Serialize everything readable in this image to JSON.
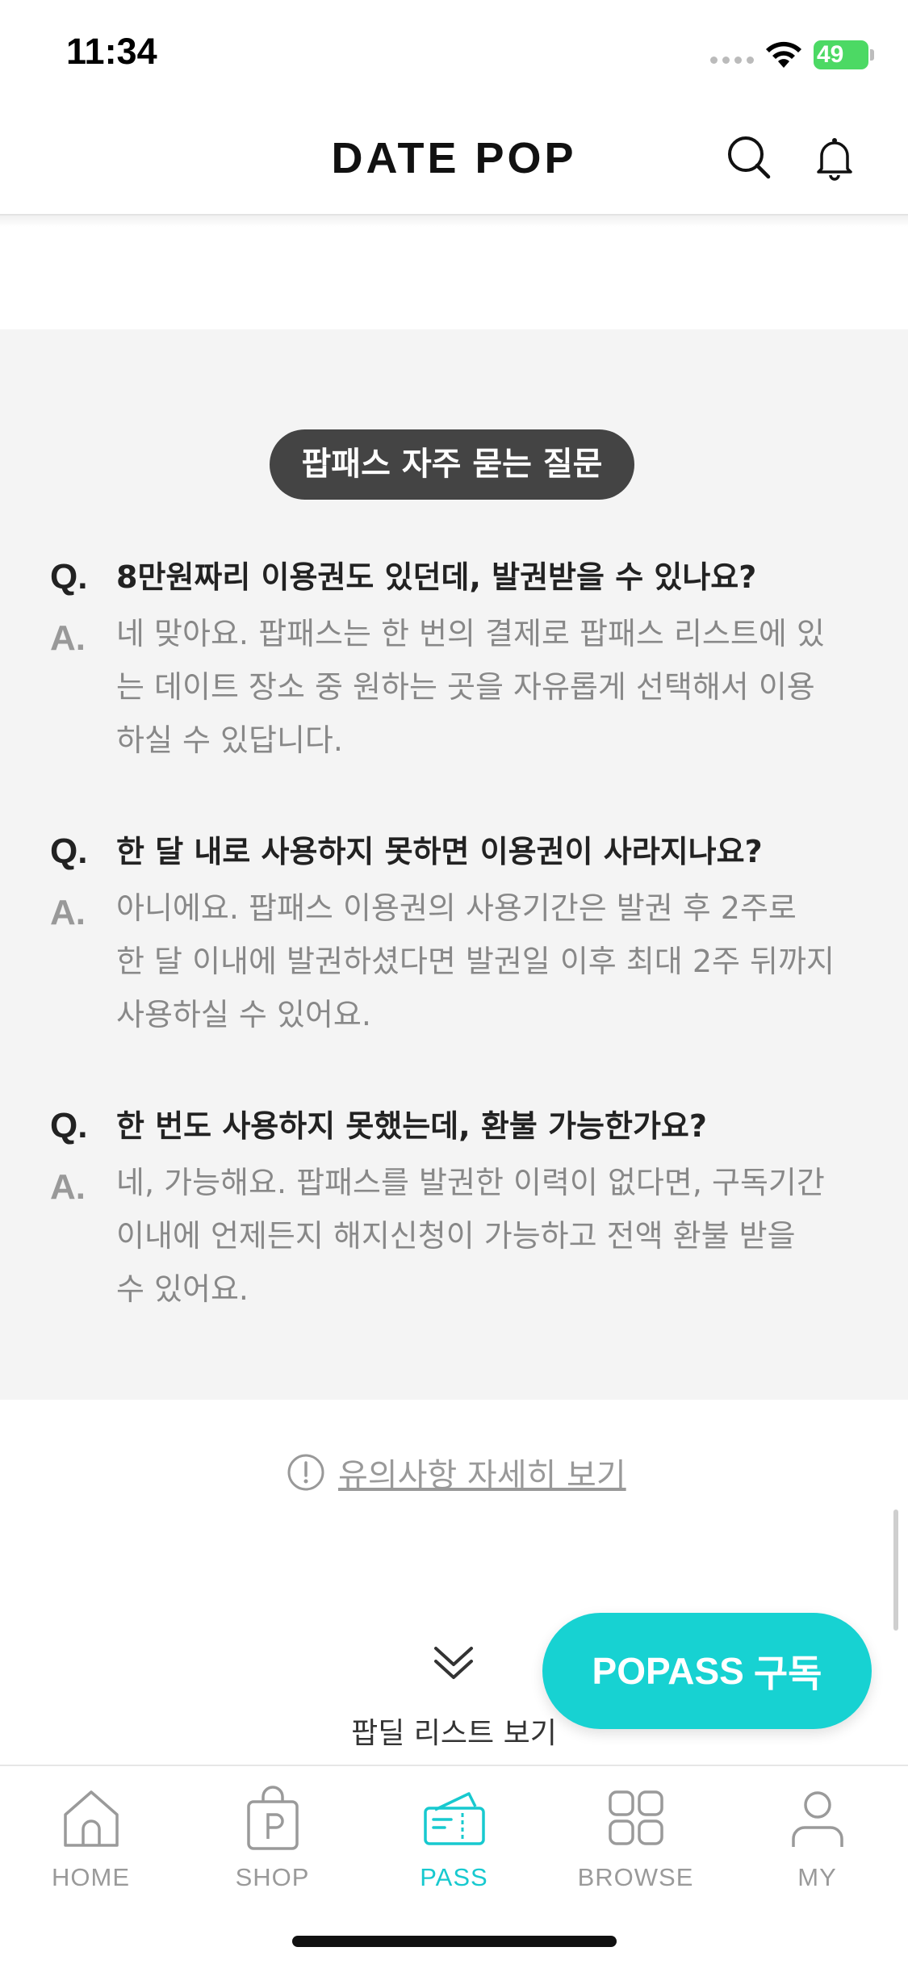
{
  "status_bar": {
    "time": "11:34",
    "battery": "49"
  },
  "header": {
    "logo": "DATE POP"
  },
  "faq": {
    "title": "팝패스 자주 묻는 질문",
    "q_mark": "Q.",
    "a_mark": "A.",
    "items": [
      {
        "question": "8만원짜리 이용권도 있던데, 발권받을 수 있나요?",
        "answer_lines": [
          "네 맞아요. 팝패스는 한 번의 결제로 팝패스 리스트에 있",
          "는 데이트 장소 중 원하는 곳을 자유롭게 선택해서 이용",
          "하실 수 있답니다."
        ]
      },
      {
        "question": "한 달 내로 사용하지 못하면 이용권이 사라지나요?",
        "answer_lines": [
          "아니에요. 팝패스 이용권의 사용기간은 발권 후 2주로",
          "한 달 이내에 발권하셨다면 발권일 이후 최대 2주 뒤까지",
          "사용하실 수 있어요."
        ]
      },
      {
        "question": "한 번도 사용하지 못했는데, 환불 가능한가요?",
        "answer_lines": [
          "네, 가능해요. 팝패스를 발권한 이력이 없다면, 구독기간",
          "이내에 언제든지 해지신청이 가능하고 전액 환불 받을",
          "수 있어요."
        ]
      }
    ]
  },
  "notice": {
    "link": "유의사항 자세히 보기"
  },
  "see_list": {
    "label": "팝딜 리스트 보기"
  },
  "popass_button": {
    "brand": "POPASS",
    "label": "구독"
  },
  "tabbar": {
    "tabs": [
      {
        "label": "HOME",
        "icon": "home-icon"
      },
      {
        "label": "SHOP",
        "icon": "shopping-bag-icon"
      },
      {
        "label": "PASS",
        "icon": "ticket-icon",
        "active": true
      },
      {
        "label": "BROWSE",
        "icon": "grid-icon"
      },
      {
        "label": "MY",
        "icon": "user-icon"
      }
    ]
  },
  "colors": {
    "accent": "#17d2d2",
    "faq_bg": "#f4f4f4",
    "pill_bg": "#444444"
  }
}
